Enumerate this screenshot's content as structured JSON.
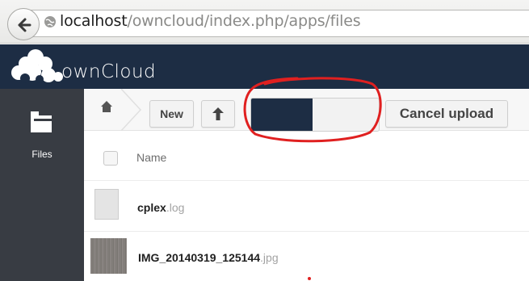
{
  "browser": {
    "url_host": "localhost",
    "url_path": "/owncloud/index.php/apps/files"
  },
  "app": {
    "name": "ownCloud"
  },
  "sidebar": {
    "items": [
      {
        "label": "Files",
        "icon": "folder-icon"
      }
    ]
  },
  "controls": {
    "new_label": "New",
    "upload_icon": "arrow-up-icon",
    "cancel_label": "Cancel upload",
    "upload_progress": 0.48
  },
  "file_list": {
    "name_header": "Name",
    "files": [
      {
        "base": "cplex",
        "ext": ".log",
        "thumb": "file-icon"
      },
      {
        "base": "IMG_20140319_125144",
        "ext": ".jpg",
        "thumb": "image-thumbnail"
      }
    ]
  },
  "colors": {
    "header_bg": "#1d2d44",
    "sidebar_bg": "#383c43",
    "progress_fill": "#1d2d44",
    "annotation": "#e02020"
  }
}
